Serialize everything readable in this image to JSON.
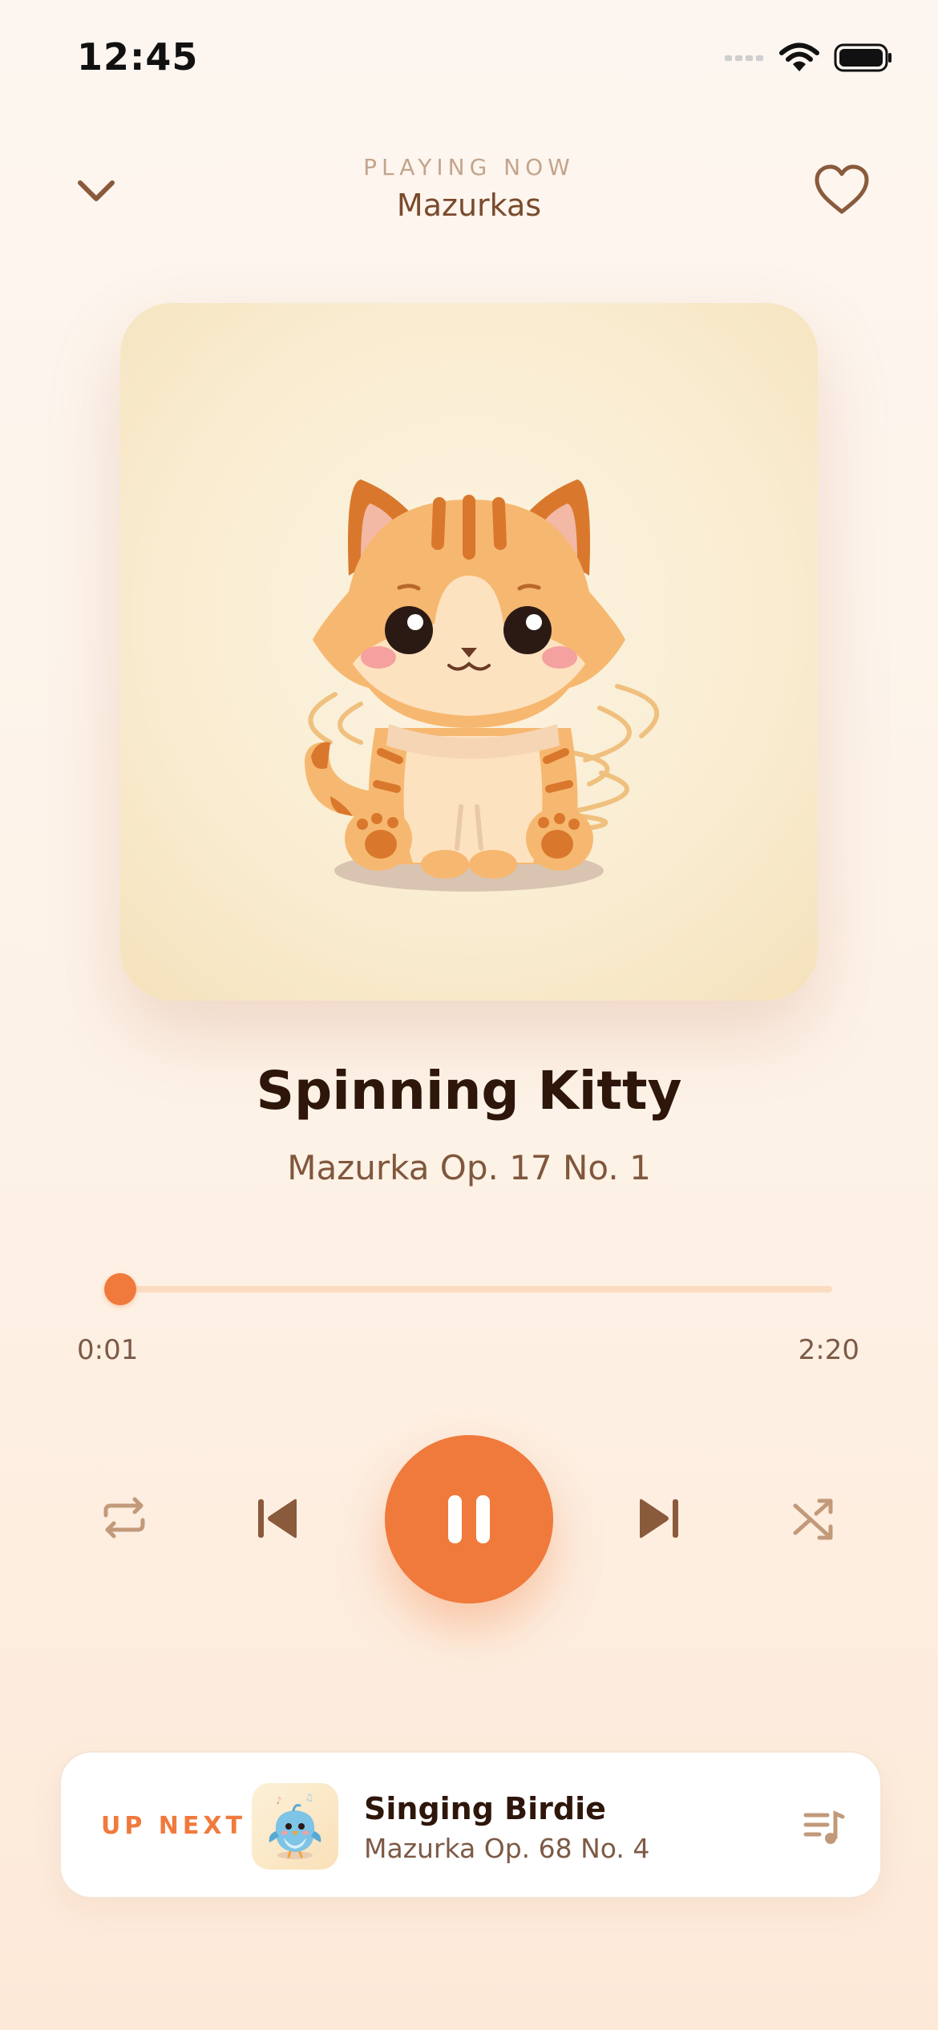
{
  "status_bar": {
    "time": "12:45",
    "icons": [
      "cellular-icon",
      "wifi-icon",
      "battery-icon"
    ]
  },
  "header": {
    "eyebrow": "PLAYING NOW",
    "playlist": "Mazurkas",
    "icons": [
      "chevron-down-icon",
      "heart-icon"
    ]
  },
  "track": {
    "title": "Spinning Kitty",
    "subtitle": "Mazurka Op. 17 No. 1",
    "artwork": "spinning-kitty-illustration"
  },
  "progress": {
    "elapsed": "0:01",
    "duration": "2:20",
    "fraction": 0.007
  },
  "controls": {
    "icons": [
      "repeat-icon",
      "previous-icon",
      "pause-icon",
      "next-icon",
      "shuffle-icon"
    ],
    "state": "playing"
  },
  "up_next": {
    "label": "UP NEXT",
    "title": "Singing Birdie",
    "subtitle": "Mazurka Op. 68 No. 4",
    "artwork": "singing-birdie-illustration",
    "icon": "queue-icon"
  },
  "colors": {
    "accent": "#f07a3c",
    "track_bg": "#fcdcc1",
    "text_dark": "#2e160a",
    "text_muted": "#80573d",
    "icon_brown": "#8a5a3c"
  }
}
